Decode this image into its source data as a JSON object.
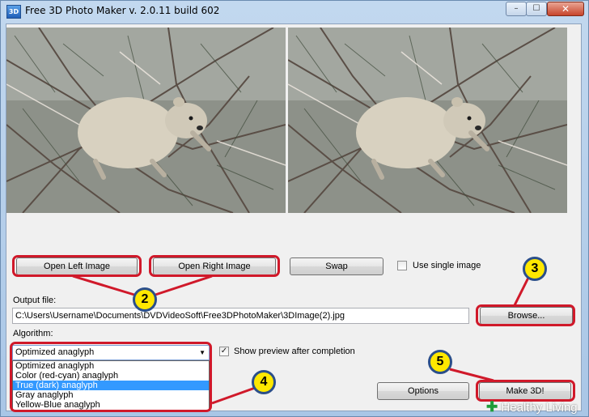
{
  "window": {
    "icon_text": "3D",
    "title": "Free 3D Photo Maker  v. 2.0.11 build 602",
    "min_glyph": "–",
    "max_glyph": "☐",
    "close_glyph": "✕"
  },
  "toolbar": {
    "open_left_label": "Open Left Image",
    "open_right_label": "Open Right Image",
    "swap_label": "Swap",
    "use_single_label": "Use single image",
    "use_single_checked": false
  },
  "output": {
    "label": "Output file:",
    "value": "C:\\Users\\Username\\Documents\\DVDVideoSoft\\Free3DPhotoMaker\\3DImage(2).jpg",
    "browse_label": "Browse..."
  },
  "algorithm": {
    "label": "Algorithm:",
    "selected": "Optimized anaglyph",
    "options": [
      "Optimized anaglyph",
      "Color (red-cyan) anaglyph",
      "True (dark) anaglyph",
      "Gray anaglyph",
      "Yellow-Blue anaglyph"
    ],
    "highlighted_index": 2
  },
  "preview": {
    "label": "Show preview after completion",
    "checked": true,
    "check_glyph": "✓"
  },
  "actions": {
    "options_label": "Options",
    "make3d_label": "Make 3D!"
  },
  "callouts": [
    "2",
    "3",
    "4",
    "5"
  ],
  "colors": {
    "highlight": "#d0192a",
    "callout_fill": "#ffe800",
    "callout_border": "#2b4f8a",
    "selection": "#3399ff"
  },
  "watermark": {
    "plus": "✚",
    "text": "Healthy Living"
  }
}
